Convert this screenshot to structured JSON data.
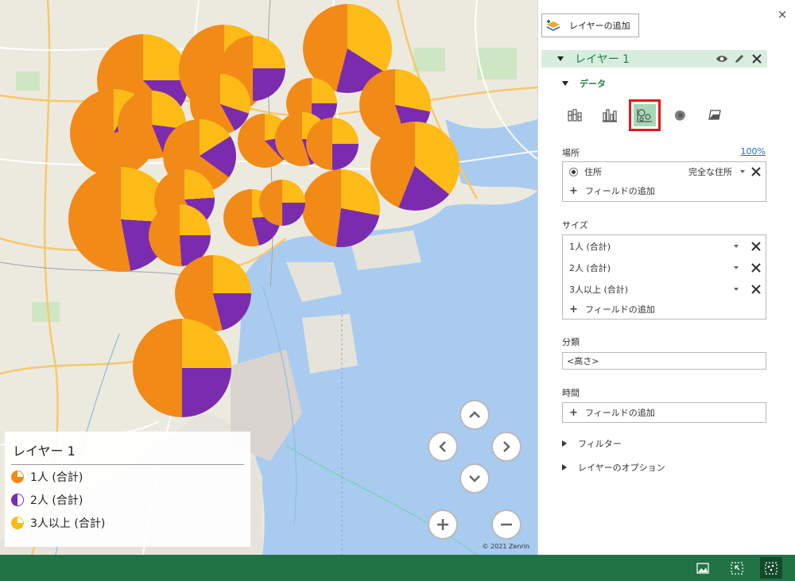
{
  "legend": {
    "title": "レイヤー 1",
    "items": [
      {
        "label": "1人 (合計)",
        "color": "#f28a18"
      },
      {
        "label": "2人 (合計)",
        "color": "#7b2cae"
      },
      {
        "label": "3人以上 (合計)",
        "color": "#fdbb18"
      }
    ]
  },
  "map": {
    "copyright": "© 2021 Zenrin",
    "nav_icons": [
      "up-arrow-icon",
      "left-arrow-icon",
      "right-arrow-icon",
      "down-arrow-icon",
      "zoom-in-icon",
      "zoom-out-icon"
    ]
  },
  "panel": {
    "add_layer_label": "レイヤーの追加",
    "close_icon": "×",
    "layer_name": "レイヤー 1",
    "data_section": "データ",
    "viz_types": [
      "stacked-column-icon",
      "clustered-column-icon",
      "bubble-icon",
      "heat-map-icon",
      "region-icon"
    ],
    "selected_viz": "bubble-icon",
    "location": {
      "label": "場所",
      "match_pct": "100%",
      "field_name": "住所",
      "field_type": "完全な住所",
      "add_field": "フィールドの追加"
    },
    "size": {
      "label": "サイズ",
      "fields": [
        "1人 (合計)",
        "2人 (合計)",
        "3人以上 (合計)"
      ],
      "add_field": "フィールドの追加"
    },
    "category": {
      "label": "分類",
      "value": "<高さ>"
    },
    "time": {
      "label": "時間",
      "add_field": "フィールドの追加"
    },
    "filter_label": "フィルター",
    "options_label": "レイヤーのオプション"
  },
  "colors": {
    "accent_green": "#217346",
    "one_person": "#f28a18",
    "two_person": "#7b2cae",
    "three_plus": "#fdbb18"
  }
}
